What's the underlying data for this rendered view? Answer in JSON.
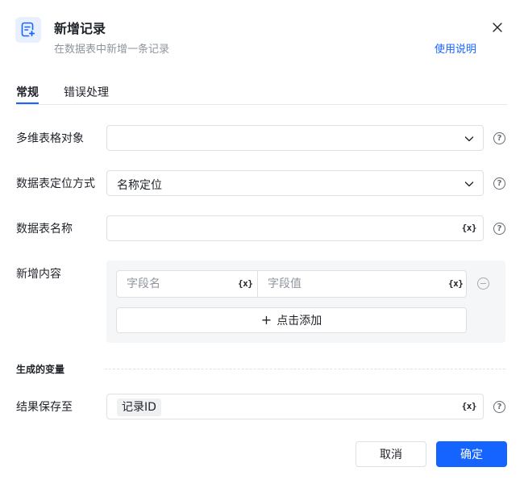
{
  "header": {
    "icon": "record-add-icon",
    "title": "新增记录",
    "subtitle": "在数据表中新增一条记录",
    "help_link": "使用说明",
    "accent_color": "#1664ff"
  },
  "tabs": [
    {
      "label": "常规",
      "active": true
    },
    {
      "label": "错误处理",
      "active": false
    }
  ],
  "form": {
    "table_object": {
      "label": "多维表格对象",
      "value": ""
    },
    "locate_method": {
      "label": "数据表定位方式",
      "value": "名称定位"
    },
    "table_name": {
      "label": "数据表名称",
      "value": "",
      "var_icon": "{x}"
    },
    "new_content": {
      "label": "新增内容",
      "field_name_placeholder": "字段名",
      "field_value_placeholder": "字段值",
      "var_icon": "{x}",
      "add_label": "点击添加"
    }
  },
  "output": {
    "section_title": "生成的变量",
    "save_to": {
      "label": "结果保存至",
      "value": "记录ID",
      "var_icon": "{x}"
    }
  },
  "footer": {
    "cancel_label": "取消",
    "confirm_label": "确定"
  }
}
